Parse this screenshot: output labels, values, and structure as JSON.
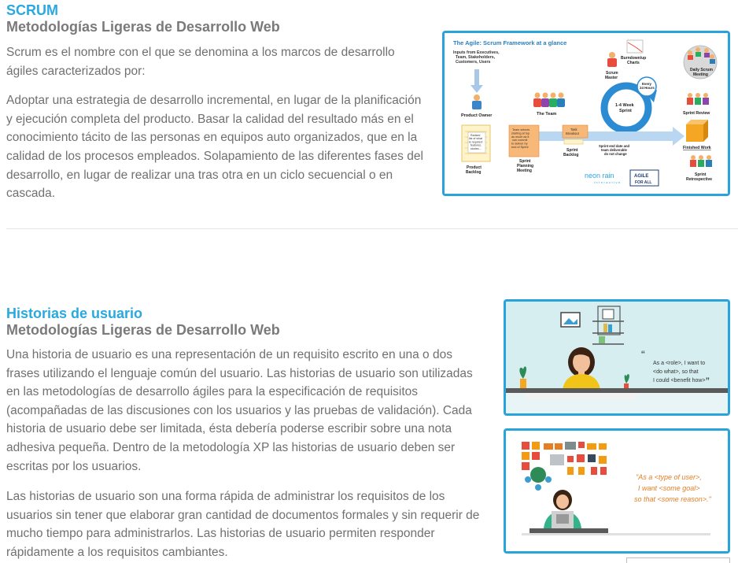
{
  "scrum": {
    "title": "SCRUM",
    "subtitle": "Metodologías Ligeras de Desarrollo Web",
    "para1": "Scrum es el nombre con el que se denomina a los marcos de desarrollo ágiles caracterizados por:",
    "para2": "Adoptar una estrategia de desarrollo incremental, en lugar de la planificación y ejecución completa del producto. Basar la calidad del resultado más en el conocimiento tácito de las personas en equipos auto organizados, que en la calidad de los procesos empleados. Solapamiento de las diferentes fases del desarrollo, en lugar de realizar una tras otra en un ciclo secuencial o en cascada.",
    "figure": {
      "title": "The Agile: Scrum Framework at a glance",
      "inputs": "Inputs from Executives, Team, Stakeholders, Customers, Users",
      "product_owner": "Product Owner",
      "the_team": "The Team",
      "scrum_master": "Scrum Master",
      "burndown": "Burndown/up Charts",
      "daily_meeting": "Daily Scrum Meeting",
      "every_24h": "Every 24 Hours",
      "sprint_len": "1-4 Week Sprint",
      "sprint_review": "Sprint Review",
      "finished_work": "Finished Work",
      "sprint_retro": "Sprint Retrospective",
      "product_backlog": "Product Backlog",
      "ranked_list": "Ranked list of what is required: features, stories...",
      "planning_note": "Team selects starting at top as much as it can commit to deliver by end of Sprint",
      "planning_meeting": "Sprint Planning Meeting",
      "task_breakout": "Task Breakout",
      "sprint_backlog": "Sprint Backlog",
      "end_date": "Sprint end date and team deliverable do not change",
      "logo1": "neon rain",
      "logo1_sub": "interactive",
      "logo2_line1": "AGILE",
      "logo2_line2": "FOR ALL"
    }
  },
  "historias": {
    "title": "Historias de usuario",
    "subtitle": "Metodologías Ligeras de Desarrollo Web",
    "para1": "Una historia de usuario es una representación de un requisito escrito en una o dos frases utilizando el lenguaje común del usuario. Las historias de usuario son utilizadas en las metodologías de desarrollo ágiles para la especificación de requisitos (acompañadas de las discusiones con los usuarios y las pruebas de validación). Cada historia de usuario debe ser limitada, ésta debería poderse escribir sobre una nota adhesiva pequeña. Dentro de la metodología XP las historias de usuario deben ser escritas por los usuarios.",
    "para2": "Las historias de usuario son una forma rápida de administrar los requisitos de los usuarios sin tener que elaborar gran cantidad de documentos formales y sin requerir de mucho tiempo para administrarlos. Las historias de usuario permiten responder rápidamente a los requisitos cambiantes.",
    "img1": {
      "line1": "As a <role>, I want to",
      "line2": "<do what>, so that",
      "line3": "I could <benefit how>"
    },
    "img2": {
      "line1": "\"As a <type of user>,",
      "line2": "I want <some goal>",
      "line3": "so that <some reason>.\""
    }
  },
  "colors": {
    "accent": "#2aa8e0",
    "frame": "#29a3dc",
    "subtitle": "#7a7a7a",
    "body": "#707070",
    "orange": "#f39c12"
  }
}
